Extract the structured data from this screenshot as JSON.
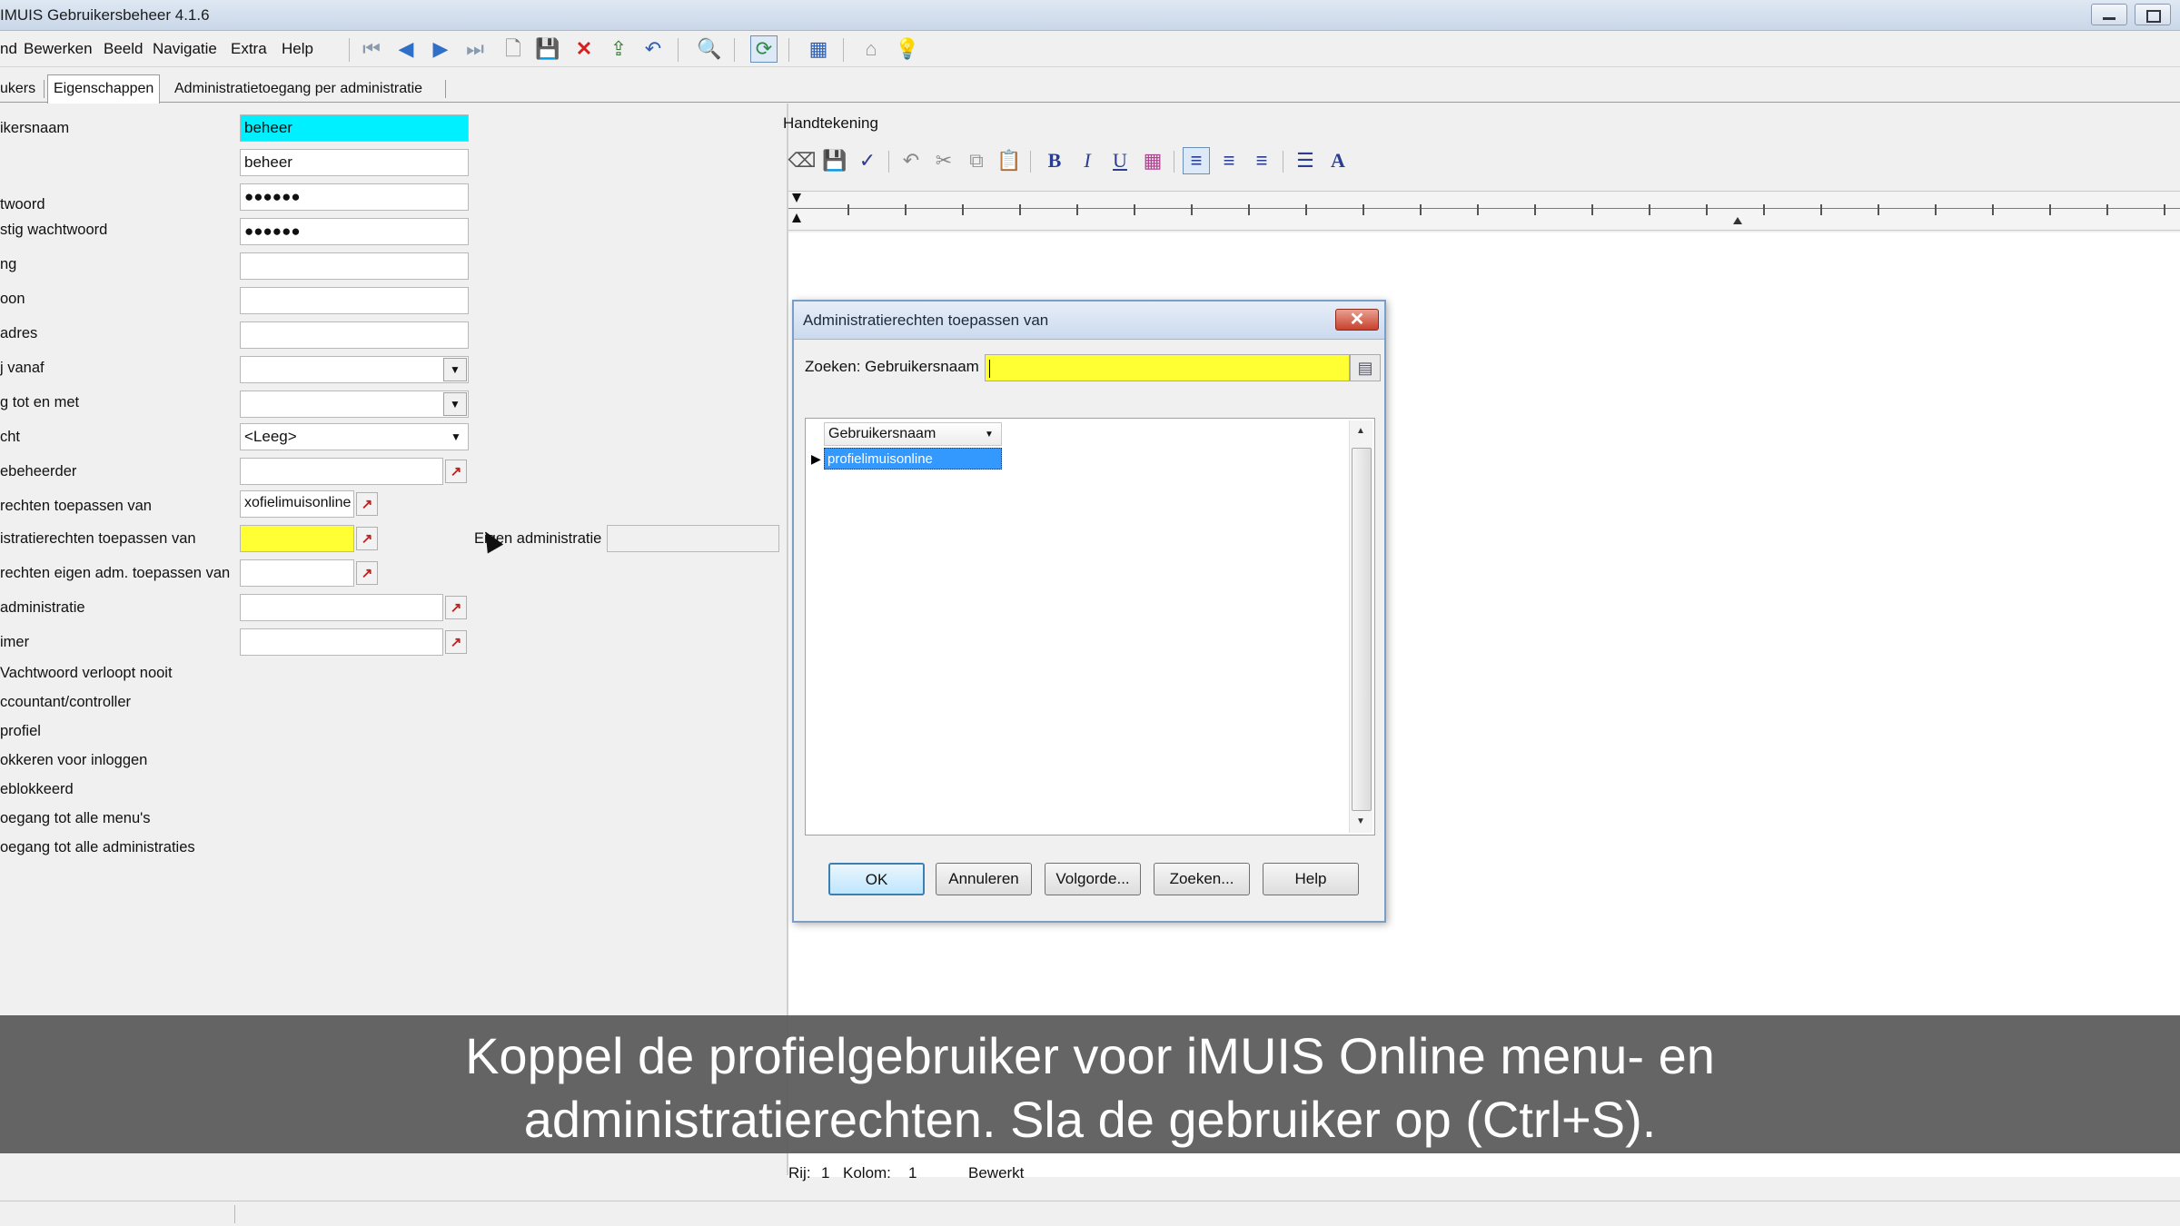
{
  "window": {
    "title": "IMUIS Gebruikersbeheer 4.1.6"
  },
  "menu": {
    "items": [
      "nd",
      "Bewerken",
      "Beeld",
      "Navigatie",
      "Extra",
      "Help"
    ]
  },
  "toolbar": {
    "icons": [
      "first-record-icon",
      "previous-record-icon",
      "next-record-icon",
      "last-record-icon",
      "new-document-icon",
      "save-icon",
      "delete-icon",
      "export-icon",
      "undo-icon",
      "find-icon",
      "refresh-icon",
      "calendar-icon",
      "home-icon",
      "help-icon"
    ]
  },
  "tabs": [
    {
      "label": "ukers"
    },
    {
      "label": "Eigenschappen",
      "selected": true
    },
    {
      "label": "Administratietoegang per administratie"
    }
  ],
  "form": {
    "labels": [
      "ikersnaam",
      "",
      "twoord",
      "stig wachtwoord",
      "ng",
      "oon",
      "adres",
      "j vanaf",
      "g tot en met",
      "cht",
      "ebeheerder",
      "rechten toepassen van",
      "istratierechten toepassen van",
      "rechten eigen adm. toepassen van",
      " administratie",
      "imer",
      "Vachtwoord verloopt nooit",
      "ccountant/controller",
      " profiel",
      "okkeren voor inloggen",
      "eblokkeerd",
      "oegang tot alle menu's",
      "oegang tot alle administraties"
    ],
    "username": "beheer",
    "fullname": "beheer",
    "password": "●●●●●●",
    "password_confirm": "●●●●●●",
    "rights_select": "<Leeg>",
    "rights_apply_from": "xofielimuisonline",
    "own_admin_label": "Eigen administratie"
  },
  "editor": {
    "label": "Handtekening",
    "status_row_label": "Rij:",
    "status_row_value": "1",
    "status_col_label": "Kolom:",
    "status_col_value": "1",
    "status_state": "Bewerkt"
  },
  "dialog": {
    "title": "Administratierechten toepassen van",
    "search_label": "Zoeken: Gebruikersnaam",
    "search_value": "",
    "grid_header": "Gebruikersnaam",
    "grid_rows": [
      "profielimuisonline"
    ],
    "buttons": {
      "ok": "OK",
      "cancel": "Annuleren",
      "order": "Volgorde...",
      "search": "Zoeken...",
      "help": "Help"
    }
  },
  "subtitle": {
    "line1": "Koppel de profielgebruiker voor iMUIS Online menu- en",
    "line2": "administratierechten. Sla de gebruiker op (Ctrl+S)."
  },
  "colors": {
    "highlight_cyan": "#00f0ff",
    "highlight_yellow": "#ffff33",
    "selection_blue": "#3399ff"
  }
}
